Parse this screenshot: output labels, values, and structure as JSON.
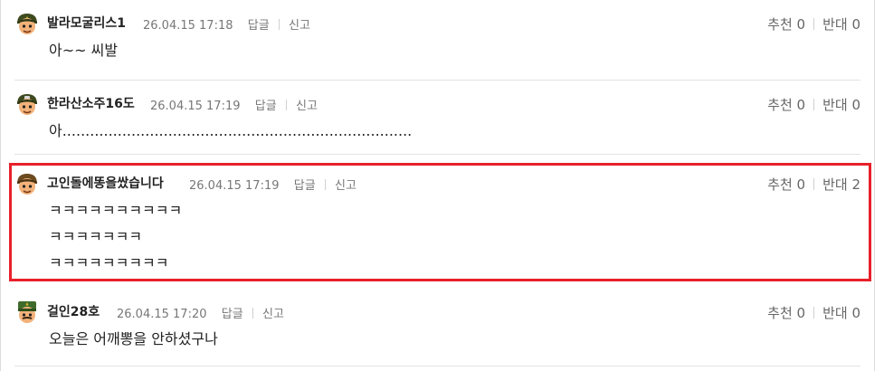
{
  "comments": [
    {
      "nickname": "발라모굴리스1",
      "date": "26.04.15 17:18",
      "reply_label": "답글",
      "report_label": "신고",
      "recommend_label": "추천 0",
      "oppose_label": "반대 0",
      "lines": [
        "아~~ 씨발"
      ],
      "avatar_icon": "helmet-soldier-avatar-icon"
    },
    {
      "nickname": "한라산소주16도",
      "date": "26.04.15 17:19",
      "reply_label": "답글",
      "report_label": "신고",
      "recommend_label": "추천 0",
      "oppose_label": "반대 0",
      "lines": [
        "아............................................................................"
      ],
      "avatar_icon": "helmet-soldier-avatar-icon"
    },
    {
      "nickname": "고인돌에똥을쌌습니다",
      "date": "26.04.15 17:19",
      "reply_label": "답글",
      "report_label": "신고",
      "recommend_label": "추천 0",
      "oppose_label": "반대 2",
      "lines": [
        "ㅋㅋㅋㅋㅋㅋㅋㅋㅋㅋ",
        "ㅋㅋㅋㅋㅋㅋㅋ",
        "ㅋㅋㅋㅋㅋㅋㅋㅋㅋ"
      ],
      "avatar_icon": "helmet-soldier-avatar-icon"
    },
    {
      "nickname": "걸인28호",
      "date": "26.04.15 17:20",
      "reply_label": "답글",
      "report_label": "신고",
      "recommend_label": "추천 0",
      "oppose_label": "반대 0",
      "lines": [
        "오늘은 어깨뽕을 안하셨구나"
      ],
      "avatar_icon": "general-soldier-avatar-icon"
    }
  ],
  "colors": {
    "highlight_border": "#e8202a",
    "helmet": "#3d4a1f",
    "skin": "#f2b27a"
  }
}
